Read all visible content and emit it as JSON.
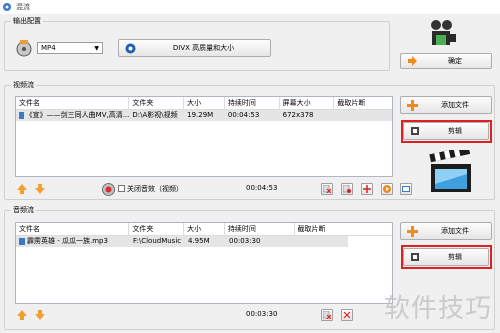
{
  "window": {
    "title": "混流"
  },
  "output": {
    "group_label": "输出配置",
    "format_value": "MP4",
    "quality_label": "DIVX 高质量和大小",
    "ok_label": "确定"
  },
  "video": {
    "group_label": "视频流",
    "add_file_label": "添加文件",
    "edit_label": "剪辑",
    "columns": [
      "文件名",
      "文件夹",
      "大小",
      "持续时间",
      "屏幕大小",
      "截取片断"
    ],
    "rows": [
      {
        "name": "《宣》——剑三同人曲MV,高清...",
        "folder": "D:\\A影视\\视频",
        "size": "19.29M",
        "duration": "00:04:53",
        "screen": "672x378",
        "clip": ""
      }
    ],
    "mute_label": "关闭音效（视频）",
    "total_time": "00:04:53"
  },
  "audio": {
    "group_label": "音频流",
    "add_file_label": "添加文件",
    "edit_label": "剪辑",
    "columns": [
      "文件名",
      "文件夹",
      "大小",
      "持续时间",
      "截取片断"
    ],
    "rows": [
      {
        "name": "霹雳英雄 - 瓜瓜一族.mp3",
        "folder": "F:\\CloudMusic",
        "size": "4.95M",
        "duration": "00:03:30",
        "clip": ""
      }
    ],
    "total_time": "00:03:30"
  },
  "watermark": "软件技巧",
  "colors": {
    "highlight": "#e02020",
    "add_icon": "#f08a1c",
    "list_row": "#e5e5e5"
  }
}
